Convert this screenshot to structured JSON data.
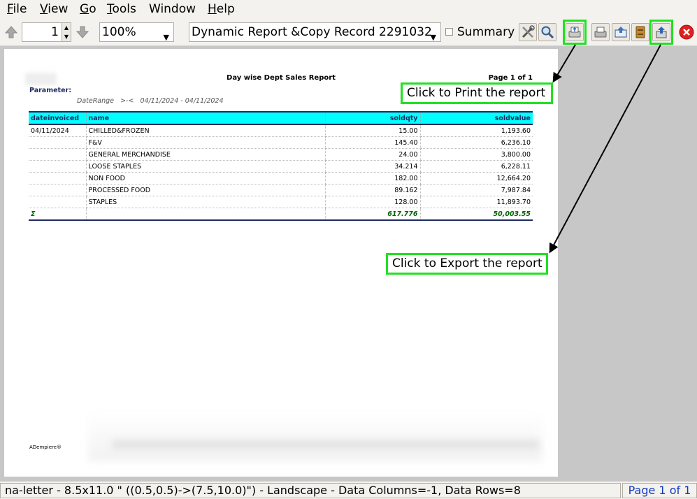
{
  "menu": [
    {
      "key": "F",
      "rest": "ile"
    },
    {
      "key": "V",
      "rest": "iew"
    },
    {
      "key": "G",
      "rest": "o"
    },
    {
      "key": "T",
      "rest": "ools"
    },
    {
      "key": "W",
      "rest": "indow",
      "plain": "Window"
    },
    {
      "key": "H",
      "rest": "elp"
    }
  ],
  "toolbar": {
    "page_number": "1",
    "zoom": "100%",
    "report_selector": "Dynamic Report &Copy Record 2291032",
    "summary_label": "Summary",
    "summary_checked": false
  },
  "report": {
    "title": "Day wise Dept Sales Report",
    "page_label": "Page 1 of 1",
    "parameter_heading": "Parameter:",
    "parameter_name": "DateRange",
    "parameter_op": ">-<",
    "parameter_value": "04/11/2024 - 04/11/2024",
    "columns": [
      "dateinvoiced",
      "name",
      "soldqty",
      "soldvalue"
    ],
    "rows": [
      [
        "04/11/2024",
        "CHILLED&FROZEN",
        "15.00",
        "1,193.60"
      ],
      [
        "",
        "F&V",
        "145.40",
        "6,236.10"
      ],
      [
        "",
        "GENERAL MERCHANDISE",
        "24.00",
        "3,800.00"
      ],
      [
        "",
        "LOOSE STAPLES",
        "34.214",
        "6,228.11"
      ],
      [
        "",
        "NON FOOD",
        "182.00",
        "12,664.20"
      ],
      [
        "",
        "PROCESSED FOOD",
        "89.162",
        "7,987.84"
      ],
      [
        "",
        "STAPLES",
        "128.00",
        "11,893.70"
      ]
    ],
    "total": {
      "label": "Σ",
      "name": "",
      "soldqty": "617.776",
      "soldvalue": "50,003.55"
    },
    "footer": "ADempiere®"
  },
  "annotations": {
    "print": "Click to Print the report",
    "export": "Click to Export the report"
  },
  "status": {
    "info": "na-letter - 8.5x11.0 \" ((0.5,0.5)->(7.5,10.0)\") - Landscape - Data Columns=-1, Data Rows=8",
    "page": "Page 1 of 1"
  },
  "colors": {
    "header_fill": "#00ffff",
    "header_text": "#1e2b5f",
    "total_text": "#006400",
    "highlight": "#22e022",
    "page_indicator": "#1238c0"
  },
  "icons": [
    "arrow-up-icon",
    "arrow-down-icon",
    "customize-icon",
    "find-icon",
    "print-icon",
    "print-preview-icon",
    "send-mail-icon",
    "archive-icon",
    "export-icon",
    "close-icon"
  ]
}
